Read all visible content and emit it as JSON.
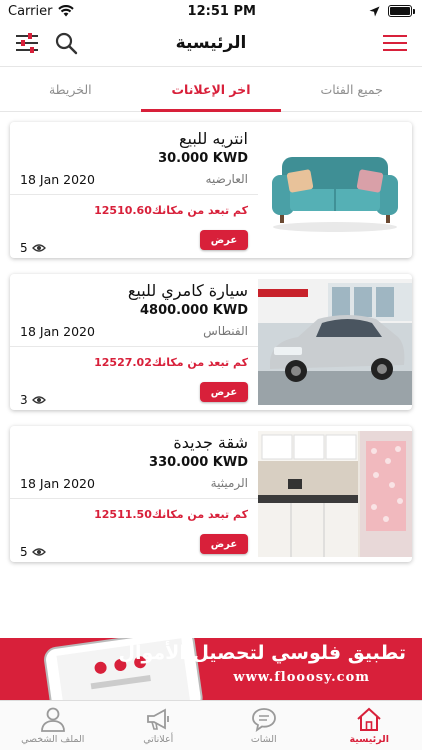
{
  "status": {
    "carrier": "Carrier",
    "time": "12:51 PM"
  },
  "header": {
    "title": "الرئيسية"
  },
  "tabs": [
    {
      "label": "جميع الفئات",
      "active": false
    },
    {
      "label": "اخر الإعلانات",
      "active": true
    },
    {
      "label": "الخريطة",
      "active": false
    }
  ],
  "listings": [
    {
      "title": "انتريه للبيع",
      "price": "30.000 KWD",
      "date": "18 Jan 2020",
      "location": "العارضيه",
      "distance_value": "12510.60",
      "distance_label": "كم تبعد من مكانك",
      "button": "عرض",
      "views": "5",
      "image": "sofa-photo"
    },
    {
      "title": "سيارة كامري للبيع",
      "price": "4800.000 KWD",
      "date": "18 Jan 2020",
      "location": "الفنطاس",
      "distance_value": "12527.02",
      "distance_label": "كم تبعد من مكانك",
      "button": "عرض",
      "views": "3",
      "image": "car-photo"
    },
    {
      "title": "شقة جديدة",
      "price": "330.000 KWD",
      "date": "18 Jan 2020",
      "location": "الرميثية",
      "distance_value": "12511.50",
      "distance_label": "كم تبعد من مكانك",
      "button": "عرض",
      "views": "5",
      "image": "kitchen-photo"
    }
  ],
  "banner": {
    "headline": "تطبيق فلوسي لتحصيل الأموال",
    "url": "www.flooosy.com"
  },
  "tabbar": [
    {
      "label": "الرئيسية",
      "icon": "home-icon",
      "active": true
    },
    {
      "label": "الشات",
      "icon": "chat-icon",
      "active": false
    },
    {
      "label": "أعلاناتي",
      "icon": "megaphone-icon",
      "active": false
    },
    {
      "label": "الملف الشخصي",
      "icon": "profile-icon",
      "active": false
    }
  ],
  "colors": {
    "accent": "#d8203a",
    "muted": "#8e8e8e"
  }
}
